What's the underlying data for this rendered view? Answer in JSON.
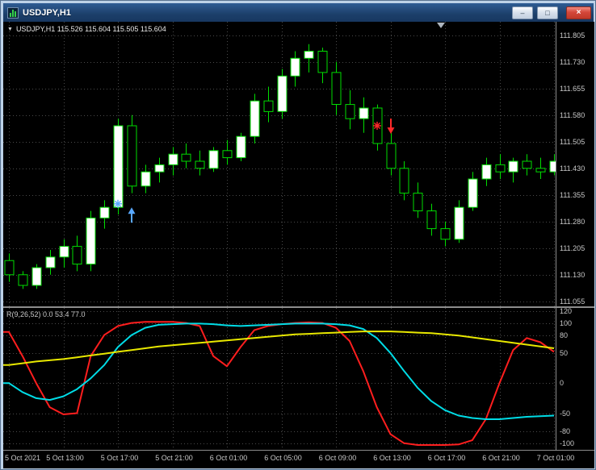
{
  "window": {
    "title": "USDJPY,H1",
    "minimize_glyph": "–",
    "maximize_glyph": "□",
    "close_glyph": "×"
  },
  "header": {
    "toggle_glyph": "▼",
    "symbol_ohlc": "USDJPY,H1 115.526 115.604 115.505 115.604"
  },
  "indicator_label": "R(9,26,52) 0.0 53.4 77.0",
  "colors": {
    "background": "#000000",
    "grid": "#4a4a4a",
    "candle_outline": "#00dd00",
    "bull_fill": "#ffffff",
    "bear_fill": "#000000",
    "axis_text": "#c8c8c8",
    "buy_signal": "#59a8ff",
    "sell_signal": "#ff2a2a",
    "titlebar": "#1c3f6a",
    "frame": "#bdd2e8",
    "close_button": "#d4473a"
  },
  "chart_data": {
    "type": "candlestick",
    "symbol": "USDJPY",
    "timeframe": "H1",
    "grid": true,
    "x_labels": [
      "5 Oct 2021",
      "5 Oct 13:00",
      "5 Oct 17:00",
      "5 Oct 21:00",
      "6 Oct 01:00",
      "6 Oct 05:00",
      "6 Oct 09:00",
      "6 Oct 13:00",
      "6 Oct 17:00",
      "6 Oct 21:00",
      "7 Oct 01:00"
    ],
    "x_label_every": 4,
    "main": {
      "ylim": [
        111.041,
        111.843
      ],
      "yticks": [
        "111.805",
        "111.730",
        "111.655",
        "111.580",
        "111.505",
        "111.430",
        "111.355",
        "111.280",
        "111.205",
        "111.130",
        "111.055"
      ],
      "candles": [
        [
          "5 Oct 09:00",
          111.17,
          111.19,
          111.11,
          111.13
        ],
        [
          "5 Oct 10:00",
          111.13,
          111.14,
          111.09,
          111.1
        ],
        [
          "5 Oct 11:00",
          111.1,
          111.16,
          111.09,
          111.15
        ],
        [
          "5 Oct 12:00",
          111.15,
          111.2,
          111.13,
          111.18
        ],
        [
          "5 Oct 13:00",
          111.18,
          111.23,
          111.15,
          111.21
        ],
        [
          "5 Oct 14:00",
          111.21,
          111.24,
          111.14,
          111.16
        ],
        [
          "5 Oct 15:00",
          111.16,
          111.31,
          111.14,
          111.29
        ],
        [
          "5 Oct 16:00",
          111.29,
          111.34,
          111.26,
          111.32
        ],
        [
          "5 Oct 17:00",
          111.32,
          111.57,
          111.3,
          111.55
        ],
        [
          "5 Oct 18:00",
          111.55,
          111.58,
          111.36,
          111.38
        ],
        [
          "5 Oct 19:00",
          111.38,
          111.44,
          111.36,
          111.42
        ],
        [
          "5 Oct 20:00",
          111.42,
          111.46,
          111.39,
          111.44
        ],
        [
          "5 Oct 21:00",
          111.44,
          111.49,
          111.41,
          111.47
        ],
        [
          "5 Oct 22:00",
          111.47,
          111.5,
          111.43,
          111.45
        ],
        [
          "5 Oct 23:00",
          111.45,
          111.48,
          111.41,
          111.43
        ],
        [
          "6 Oct 00:00",
          111.43,
          111.49,
          111.42,
          111.48
        ],
        [
          "6 Oct 01:00",
          111.48,
          111.51,
          111.44,
          111.46
        ],
        [
          "6 Oct 02:00",
          111.46,
          111.53,
          111.45,
          111.52
        ],
        [
          "6 Oct 03:00",
          111.52,
          111.64,
          111.5,
          111.62
        ],
        [
          "6 Oct 04:00",
          111.62,
          111.66,
          111.56,
          111.59
        ],
        [
          "6 Oct 05:00",
          111.59,
          111.71,
          111.57,
          111.69
        ],
        [
          "6 Oct 06:00",
          111.69,
          111.76,
          111.66,
          111.74
        ],
        [
          "6 Oct 07:00",
          111.74,
          111.78,
          111.7,
          111.76
        ],
        [
          "6 Oct 08:00",
          111.76,
          111.77,
          111.67,
          111.7
        ],
        [
          "6 Oct 09:00",
          111.7,
          111.73,
          111.58,
          111.61
        ],
        [
          "6 Oct 10:00",
          111.61,
          111.65,
          111.54,
          111.57
        ],
        [
          "6 Oct 11:00",
          111.57,
          111.63,
          111.53,
          111.6
        ],
        [
          "6 Oct 12:00",
          111.6,
          111.61,
          111.48,
          111.5
        ],
        [
          "6 Oct 13:00",
          111.5,
          111.53,
          111.41,
          111.43
        ],
        [
          "6 Oct 14:00",
          111.43,
          111.45,
          111.34,
          111.36
        ],
        [
          "6 Oct 15:00",
          111.36,
          111.39,
          111.29,
          111.31
        ],
        [
          "6 Oct 16:00",
          111.31,
          111.33,
          111.24,
          111.26
        ],
        [
          "6 Oct 17:00",
          111.26,
          111.28,
          111.21,
          111.23
        ],
        [
          "6 Oct 18:00",
          111.23,
          111.34,
          111.22,
          111.32
        ],
        [
          "6 Oct 19:00",
          111.32,
          111.42,
          111.31,
          111.4
        ],
        [
          "6 Oct 20:00",
          111.4,
          111.46,
          111.38,
          111.44
        ],
        [
          "6 Oct 21:00",
          111.44,
          111.47,
          111.4,
          111.42
        ],
        [
          "6 Oct 22:00",
          111.42,
          111.46,
          111.39,
          111.45
        ],
        [
          "6 Oct 23:00",
          111.45,
          111.47,
          111.41,
          111.43
        ],
        [
          "7 Oct 00:00",
          111.43,
          111.46,
          111.4,
          111.42
        ],
        [
          "7 Oct 01:00",
          111.42,
          111.47,
          111.41,
          111.45
        ]
      ],
      "signals": [
        {
          "type": "buy",
          "glyph": "star",
          "index": 8,
          "price": 111.33
        },
        {
          "type": "buy",
          "glyph": "arrow-up",
          "index": 9,
          "price": 111.32
        },
        {
          "type": "sell",
          "glyph": "star",
          "index": 27,
          "price": 111.55
        },
        {
          "type": "sell",
          "glyph": "arrow-down",
          "index": 28,
          "price": 111.57
        }
      ]
    },
    "indicator": {
      "name": "R(9,26,52)",
      "values_text": "0.0 53.4 77.0",
      "ylim": [
        -111,
        125
      ],
      "yticks": [
        "120",
        "100",
        "80",
        "50",
        "0",
        "-50",
        "-80",
        "-100"
      ],
      "series": [
        {
          "name": "red",
          "color": "#ff1e1e",
          "values": [
            85,
            45,
            0,
            -40,
            -52,
            -50,
            45,
            80,
            95,
            100,
            102,
            102,
            102,
            100,
            95,
            45,
            28,
            60,
            88,
            95,
            98,
            100,
            101,
            100,
            92,
            70,
            20,
            -40,
            -85,
            -100,
            -103,
            -103,
            -103,
            -102,
            -95,
            -60,
            0,
            55,
            75,
            68,
            52
          ]
        },
        {
          "name": "cyan",
          "color": "#00dce6",
          "values": [
            0,
            -15,
            -25,
            -28,
            -22,
            -10,
            8,
            30,
            60,
            80,
            92,
            97,
            98,
            99,
            99,
            98,
            96,
            95,
            96,
            97,
            98,
            99,
            99,
            99,
            98,
            96,
            90,
            75,
            50,
            20,
            -8,
            -30,
            -45,
            -54,
            -58,
            -60,
            -60,
            -58,
            -56,
            -55,
            -54
          ]
        },
        {
          "name": "yellow",
          "color": "#e8e800",
          "values": [
            30,
            33,
            36,
            38,
            40,
            43,
            46,
            49,
            52,
            55,
            58,
            61,
            63,
            65,
            67,
            69,
            71,
            73,
            75,
            77,
            79,
            81,
            82,
            83,
            84,
            85,
            86,
            86,
            86,
            85,
            84,
            83,
            81,
            79,
            76,
            73,
            70,
            67,
            64,
            61,
            58
          ]
        }
      ]
    }
  }
}
